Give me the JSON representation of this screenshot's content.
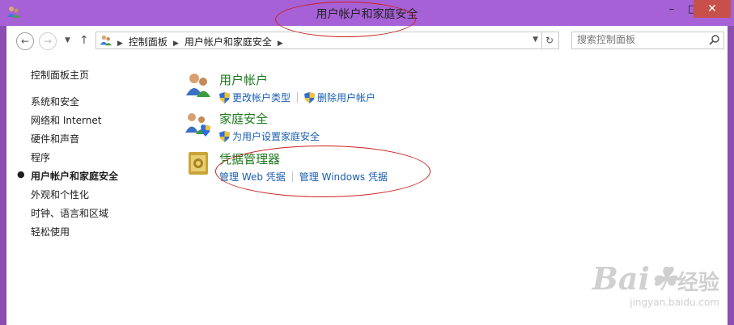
{
  "window": {
    "title": "用户帐户和家庭安全",
    "controls": {
      "minimize": "–",
      "maximize": "□",
      "close": "✕"
    }
  },
  "nav": {
    "back_icon": "back-arrow-icon",
    "forward_icon": "forward-arrow-icon",
    "recent_icon": "chevron-down-icon",
    "up_icon": "up-arrow-icon"
  },
  "address": {
    "segments": [
      "控制面板",
      "用户帐户和家庭安全"
    ],
    "refresh_icon": "refresh-icon"
  },
  "search": {
    "placeholder": "搜索控制面板"
  },
  "sidebar": {
    "home": "控制面板主页",
    "items": [
      {
        "label": "系统和安全",
        "active": false
      },
      {
        "label": "网络和 Internet",
        "active": false
      },
      {
        "label": "硬件和声音",
        "active": false
      },
      {
        "label": "程序",
        "active": false
      },
      {
        "label": "用户帐户和家庭安全",
        "active": true
      },
      {
        "label": "外观和个性化",
        "active": false
      },
      {
        "label": "时钟、语言和区域",
        "active": false
      },
      {
        "label": "轻松使用",
        "active": false
      }
    ]
  },
  "categories": [
    {
      "title": "用户帐户",
      "icon": "users-icon",
      "links": [
        {
          "label": "更改帐户类型",
          "shield": true
        },
        {
          "label": "删除用户帐户",
          "shield": true
        }
      ]
    },
    {
      "title": "家庭安全",
      "icon": "family-safety-icon",
      "links": [
        {
          "label": "为用户设置家庭安全",
          "shield": true
        }
      ]
    },
    {
      "title": "凭据管理器",
      "icon": "credential-vault-icon",
      "links": [
        {
          "label": "管理 Web 凭据",
          "shield": false
        },
        {
          "label": "管理 Windows 凭据",
          "shield": false
        }
      ]
    }
  ],
  "watermark": {
    "brand": "Bai",
    "brand2": "经验",
    "url": "jingyan.baidu.com"
  },
  "colors": {
    "titlebar": "#a661d6",
    "category_title": "#1d7a1d",
    "link": "#1a5eb0",
    "annotation": "#cc2020"
  }
}
